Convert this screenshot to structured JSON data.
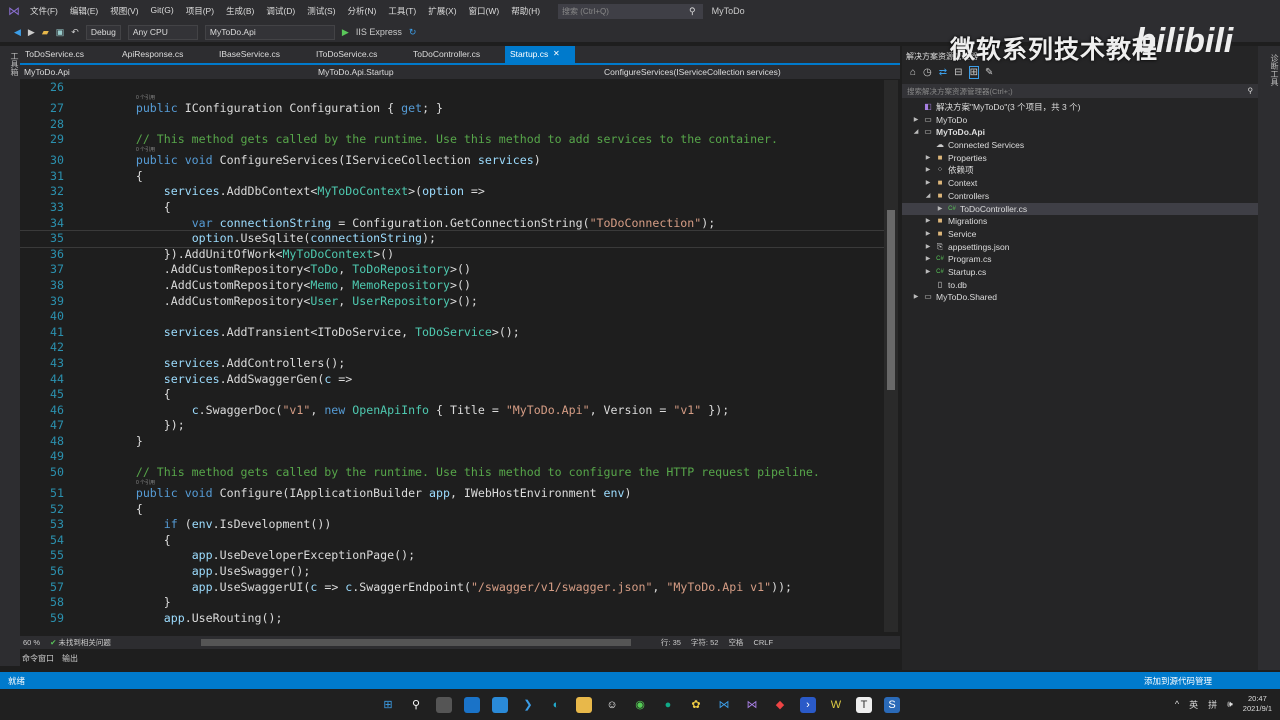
{
  "menu": {
    "items": [
      "文件(F)",
      "编辑(E)",
      "视图(V)",
      "Git(G)",
      "项目(P)",
      "生成(B)",
      "调试(D)",
      "测试(S)",
      "分析(N)",
      "工具(T)",
      "扩展(X)",
      "窗口(W)",
      "帮助(H)"
    ],
    "search_placeholder": "搜索 (Ctrl+Q)",
    "title": "MyToDo"
  },
  "toolbar": {
    "config": "Debug",
    "platform": "Any CPU",
    "project": "MyToDo.Api",
    "run": "IIS Express"
  },
  "tabs": [
    "ToDoService.cs",
    "ApiResponse.cs",
    "IBaseService.cs",
    "IToDoService.cs",
    "ToDoController.cs",
    "Startup.cs"
  ],
  "navbar": {
    "project": "MyToDo.Api",
    "class": "MyToDo.Api.Startup",
    "member": "ConfigureServices(IServiceCollection services)"
  },
  "left_strip": "工具箱",
  "right_strip": "诊断工具",
  "codelens": "0 个引用",
  "code": [
    {
      "n": "26",
      "t": []
    },
    {
      "n": "27",
      "lens": true,
      "t": [
        [
          "k",
          "public "
        ],
        [
          "p",
          "IConfiguration Configuration { "
        ],
        [
          "k",
          "get"
        ],
        [
          "p",
          "; }"
        ]
      ],
      "i": 2
    },
    {
      "n": "28",
      "t": []
    },
    {
      "n": "29",
      "i": 2,
      "t": [
        [
          "c",
          "// This method gets called by the runtime. Use this method to add services to the container."
        ]
      ]
    },
    {
      "n": "30",
      "lens": true,
      "i": 2,
      "t": [
        [
          "k",
          "public void "
        ],
        [
          "p",
          "ConfigureServices(IServiceCollection "
        ],
        [
          "v",
          "services"
        ],
        [
          "p",
          ")"
        ]
      ]
    },
    {
      "n": "31",
      "i": 2,
      "t": [
        [
          "p",
          "{"
        ]
      ]
    },
    {
      "n": "32",
      "i": 3,
      "t": [
        [
          "v",
          "services"
        ],
        [
          "p",
          ".AddDbContext<"
        ],
        [
          "t",
          "MyToDoContext"
        ],
        [
          "p",
          ">("
        ],
        [
          "v",
          "option"
        ],
        [
          "p",
          " =>"
        ]
      ]
    },
    {
      "n": "33",
      "i": 3,
      "t": [
        [
          "p",
          "{"
        ]
      ]
    },
    {
      "n": "34",
      "i": 4,
      "t": [
        [
          "k",
          "var "
        ],
        [
          "v",
          "connectionString"
        ],
        [
          "p",
          " = Configuration.GetConnectionString("
        ],
        [
          "s",
          "\"ToDoConnection\""
        ],
        [
          "p",
          ");"
        ]
      ]
    },
    {
      "n": "35",
      "i": 4,
      "cur": true,
      "t": [
        [
          "v",
          "option"
        ],
        [
          "p",
          ".UseSqlite("
        ],
        [
          "v",
          "connectionString"
        ],
        [
          "p",
          ");"
        ]
      ]
    },
    {
      "n": "36",
      "i": 3,
      "t": [
        [
          "p",
          "}).AddUnitOfWork<"
        ],
        [
          "t",
          "MyToDoContext"
        ],
        [
          "p",
          ">()"
        ]
      ]
    },
    {
      "n": "37",
      "i": 3,
      "t": [
        [
          "p",
          ".AddCustomRepository<"
        ],
        [
          "t",
          "ToDo"
        ],
        [
          "p",
          ", "
        ],
        [
          "t",
          "ToDoRepository"
        ],
        [
          "p",
          ">()"
        ]
      ]
    },
    {
      "n": "38",
      "i": 3,
      "t": [
        [
          "p",
          ".AddCustomRepository<"
        ],
        [
          "t",
          "Memo"
        ],
        [
          "p",
          ", "
        ],
        [
          "t",
          "MemoRepository"
        ],
        [
          "p",
          ">()"
        ]
      ]
    },
    {
      "n": "39",
      "i": 3,
      "t": [
        [
          "p",
          ".AddCustomRepository<"
        ],
        [
          "t",
          "User"
        ],
        [
          "p",
          ", "
        ],
        [
          "t",
          "UserRepository"
        ],
        [
          "p",
          ">();"
        ]
      ]
    },
    {
      "n": "40",
      "t": []
    },
    {
      "n": "41",
      "i": 3,
      "t": [
        [
          "v",
          "services"
        ],
        [
          "p",
          ".AddTransient<IToDoService, "
        ],
        [
          "t",
          "ToDoService"
        ],
        [
          "p",
          ">();"
        ]
      ]
    },
    {
      "n": "42",
      "t": []
    },
    {
      "n": "43",
      "i": 3,
      "t": [
        [
          "v",
          "services"
        ],
        [
          "p",
          ".AddControllers();"
        ]
      ]
    },
    {
      "n": "44",
      "i": 3,
      "t": [
        [
          "v",
          "services"
        ],
        [
          "p",
          ".AddSwaggerGen("
        ],
        [
          "v",
          "c"
        ],
        [
          "p",
          " =>"
        ]
      ]
    },
    {
      "n": "45",
      "i": 3,
      "t": [
        [
          "p",
          "{"
        ]
      ]
    },
    {
      "n": "46",
      "i": 4,
      "t": [
        [
          "v",
          "c"
        ],
        [
          "p",
          ".SwaggerDoc("
        ],
        [
          "s",
          "\"v1\""
        ],
        [
          "p",
          ", "
        ],
        [
          "k",
          "new "
        ],
        [
          "t",
          "OpenApiInfo"
        ],
        [
          "p",
          " { Title = "
        ],
        [
          "s",
          "\"MyToDo.Api\""
        ],
        [
          "p",
          ", Version = "
        ],
        [
          "s",
          "\"v1\""
        ],
        [
          "p",
          " });"
        ]
      ]
    },
    {
      "n": "47",
      "i": 3,
      "t": [
        [
          "p",
          "});"
        ]
      ]
    },
    {
      "n": "48",
      "i": 2,
      "t": [
        [
          "p",
          "}"
        ]
      ]
    },
    {
      "n": "49",
      "t": []
    },
    {
      "n": "50",
      "i": 2,
      "t": [
        [
          "c",
          "// This method gets called by the runtime. Use this method to configure the HTTP request pipeline."
        ]
      ]
    },
    {
      "n": "51",
      "lens": true,
      "i": 2,
      "t": [
        [
          "k",
          "public void "
        ],
        [
          "p",
          "Configure(IApplicationBuilder "
        ],
        [
          "v",
          "app"
        ],
        [
          "p",
          ", IWebHostEnvironment "
        ],
        [
          "v",
          "env"
        ],
        [
          "p",
          ")"
        ]
      ]
    },
    {
      "n": "52",
      "i": 2,
      "t": [
        [
          "p",
          "{"
        ]
      ]
    },
    {
      "n": "53",
      "i": 3,
      "t": [
        [
          "k",
          "if "
        ],
        [
          "p",
          "("
        ],
        [
          "v",
          "env"
        ],
        [
          "p",
          ".IsDevelopment())"
        ]
      ]
    },
    {
      "n": "54",
      "i": 3,
      "t": [
        [
          "p",
          "{"
        ]
      ]
    },
    {
      "n": "55",
      "i": 4,
      "t": [
        [
          "v",
          "app"
        ],
        [
          "p",
          ".UseDeveloperExceptionPage();"
        ]
      ]
    },
    {
      "n": "56",
      "i": 4,
      "t": [
        [
          "v",
          "app"
        ],
        [
          "p",
          ".UseSwagger();"
        ]
      ]
    },
    {
      "n": "57",
      "i": 4,
      "t": [
        [
          "v",
          "app"
        ],
        [
          "p",
          ".UseSwaggerUI("
        ],
        [
          "v",
          "c"
        ],
        [
          "p",
          " => "
        ],
        [
          "v",
          "c"
        ],
        [
          "p",
          ".SwaggerEndpoint("
        ],
        [
          "s",
          "\"/swagger/v1/swagger.json\""
        ],
        [
          "p",
          ", "
        ],
        [
          "s",
          "\"MyToDo.Api v1\""
        ],
        [
          "p",
          "));"
        ]
      ]
    },
    {
      "n": "58",
      "i": 3,
      "t": [
        [
          "p",
          "}"
        ]
      ]
    },
    {
      "n": "59",
      "i": 3,
      "t": [
        [
          "v",
          "app"
        ],
        [
          "p",
          ".UseRouting();"
        ]
      ]
    }
  ],
  "editor_status": {
    "zoom": "60 %",
    "issues": "未找到相关问题",
    "line": "行: 35",
    "char": "字符: 52",
    "ws": "空格",
    "eol": "CRLF"
  },
  "bottom_tabs": [
    "命令窗口",
    "输出"
  ],
  "statusbar": {
    "left": "就绪",
    "right": "添加到源代码管理"
  },
  "solution": {
    "header": "解决方案资源管理器",
    "search_placeholder": "搜索解决方案资源管理器(Ctrl+;)",
    "items": [
      {
        "label": "解决方案\"MyToDo\"(3 个项目，共 3 个)",
        "d": 0,
        "a": "",
        "icon": "sln"
      },
      {
        "label": "MyToDo",
        "d": 0,
        "a": "▶",
        "icon": "proj"
      },
      {
        "label": "MyToDo.Api",
        "d": 0,
        "a": "◢",
        "icon": "proj",
        "bold": true
      },
      {
        "label": "Connected Services",
        "d": 1,
        "a": "",
        "icon": "cloud"
      },
      {
        "label": "Properties",
        "d": 1,
        "a": "▶",
        "icon": "folder"
      },
      {
        "label": "依赖项",
        "d": 1,
        "a": "▶",
        "icon": "deps"
      },
      {
        "label": "Context",
        "d": 1,
        "a": "▶",
        "icon": "folder"
      },
      {
        "label": "Controllers",
        "d": 1,
        "a": "◢",
        "icon": "folder"
      },
      {
        "label": "ToDoController.cs",
        "d": 2,
        "a": "▶",
        "icon": "cs",
        "sel": true
      },
      {
        "label": "Migrations",
        "d": 1,
        "a": "▶",
        "icon": "folder"
      },
      {
        "label": "Service",
        "d": 1,
        "a": "▶",
        "icon": "folder"
      },
      {
        "label": "appsettings.json",
        "d": 1,
        "a": "▶",
        "icon": "json"
      },
      {
        "label": "Program.cs",
        "d": 1,
        "a": "▶",
        "icon": "cs"
      },
      {
        "label": "Startup.cs",
        "d": 1,
        "a": "▶",
        "icon": "cs"
      },
      {
        "label": "to.db",
        "d": 1,
        "a": "",
        "icon": "file"
      },
      {
        "label": "MyToDo.Shared",
        "d": 0,
        "a": "▶",
        "icon": "proj"
      }
    ]
  },
  "watermark": {
    "text": "微软系列技术教程",
    "logo": "bilibili"
  },
  "clock": {
    "time": "20:47",
    "date": "2021/9/1"
  },
  "tray": {
    "ime1": "英",
    "ime2": "拼"
  }
}
